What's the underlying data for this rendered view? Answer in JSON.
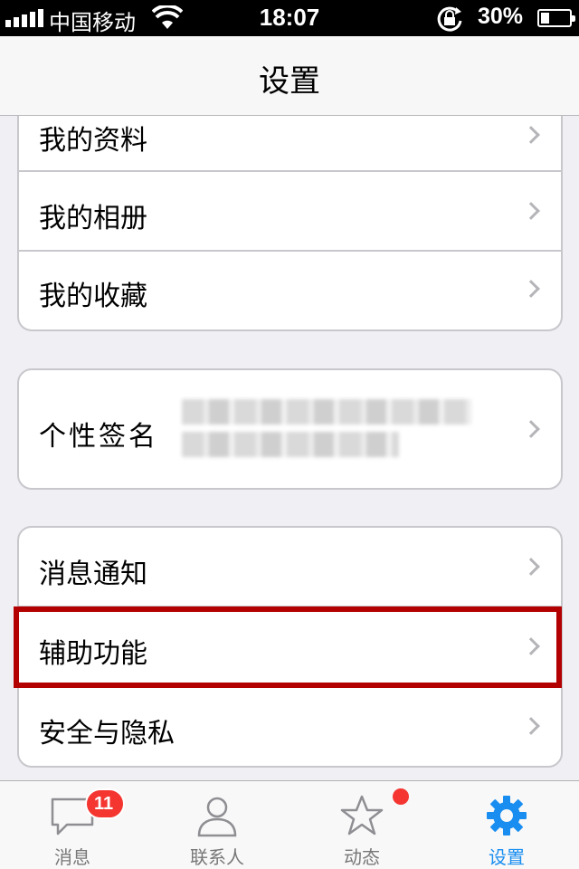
{
  "status_bar": {
    "carrier": "中国移动",
    "time": "18:07",
    "battery_percent": "30%",
    "battery_level": 0.3,
    "signal_bars": 5
  },
  "nav": {
    "title": "设置"
  },
  "groups": [
    {
      "rows": [
        {
          "label": "我的资料"
        },
        {
          "label": "我的相册"
        },
        {
          "label": "我的收藏"
        }
      ]
    },
    {
      "rows": [
        {
          "label": "个性签名"
        }
      ]
    },
    {
      "rows": [
        {
          "label": "消息通知"
        },
        {
          "label": "辅助功能"
        },
        {
          "label": "安全与隐私"
        }
      ]
    }
  ],
  "tabs": [
    {
      "label": "消息",
      "icon": "chat-bubble-icon",
      "badge": "11"
    },
    {
      "label": "联系人",
      "icon": "person-icon"
    },
    {
      "label": "动态",
      "icon": "star-icon",
      "dot": true
    },
    {
      "label": "设置",
      "icon": "gear-icon",
      "active": true
    }
  ],
  "colors": {
    "accent": "#1a8ef0",
    "badge": "#f43530",
    "highlight": "#b30000",
    "background": "#efeff4"
  }
}
